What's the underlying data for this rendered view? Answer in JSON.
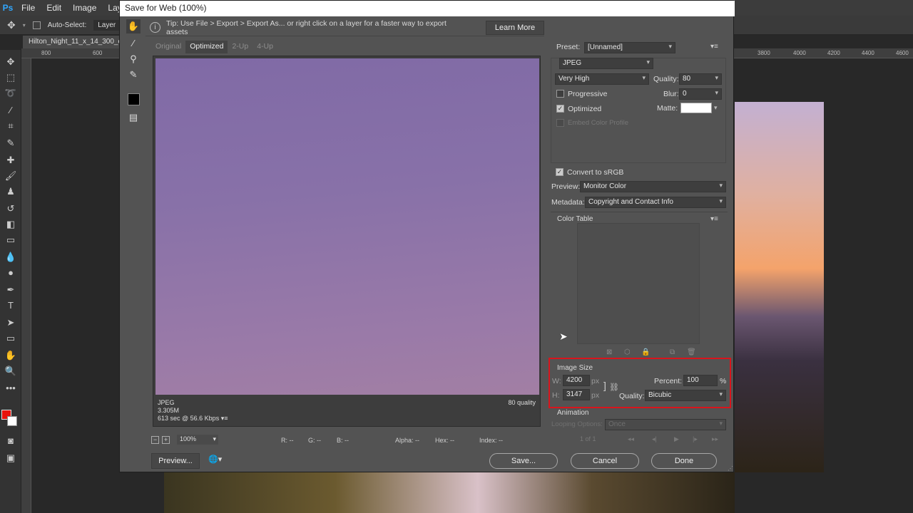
{
  "ps": {
    "logo": "Ps",
    "menu": [
      "File",
      "Edit",
      "Image",
      "Laye"
    ],
    "auto_select": "Auto-Select:",
    "layer_select": "Layer",
    "doc_tab": "Hilton_Night_11_x_14_300_c",
    "ruler_marks": [
      "800",
      "600",
      "3800",
      "4000",
      "4200",
      "4400",
      "4600"
    ]
  },
  "dialog": {
    "title": "Save for Web (100%)",
    "tip": "Tip: Use File > Export > Export As...  or right click on a layer for a faster way to export assets",
    "learn_more": "Learn More",
    "tabs": [
      "Original",
      "Optimized",
      "2-Up",
      "4-Up"
    ],
    "active_tab": "Optimized",
    "preview_info": {
      "format": "JPEG",
      "size": "3.305M",
      "time": "613 sec @ 56.6 Kbps",
      "quality": "80 quality"
    },
    "status": {
      "zoom": "100%",
      "r": "R: --",
      "g": "G: --",
      "b": "B: --",
      "alpha": "Alpha: --",
      "hex": "Hex: --",
      "index": "Index: --"
    },
    "buttons": {
      "preview": "Preview...",
      "save": "Save...",
      "cancel": "Cancel",
      "done": "Done"
    }
  },
  "settings": {
    "preset_label": "Preset:",
    "preset_value": "[Unnamed]",
    "format": "JPEG",
    "quality_level": "Very High",
    "quality_label": "Quality:",
    "quality_value": "80",
    "progressive": "Progressive",
    "progressive_checked": false,
    "blur_label": "Blur:",
    "blur_value": "0",
    "optimized": "Optimized",
    "optimized_checked": true,
    "matte_label": "Matte:",
    "embed_profile": "Embed Color Profile",
    "convert_srgb": "Convert to sRGB",
    "convert_checked": true,
    "preview_label": "Preview:",
    "preview_value": "Monitor Color",
    "metadata_label": "Metadata:",
    "metadata_value": "Copyright and Contact Info",
    "color_table": "Color Table"
  },
  "image_size": {
    "title": "Image Size",
    "w_label": "W:",
    "w_value": "4200",
    "h_label": "H:",
    "h_value": "3147",
    "unit": "px",
    "percent_label": "Percent:",
    "percent_value": "100",
    "percent_unit": "%",
    "quality_label": "Quality:",
    "quality_value": "Bicubic"
  },
  "animation": {
    "title": "Animation",
    "looping_label": "Looping Options:",
    "looping_value": "Once",
    "frame_counter": "1 of 1"
  },
  "colors": {
    "highlight_border": "#d9141c",
    "foreground_swatch": "#e8120c"
  }
}
